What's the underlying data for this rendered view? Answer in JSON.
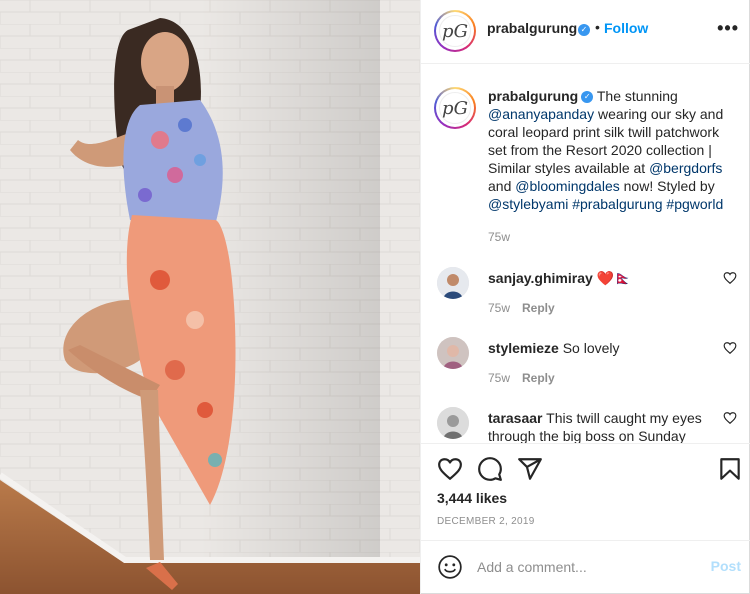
{
  "header": {
    "username": "prabalgurung",
    "verified_icon": "verified-badge-icon",
    "separator": "•",
    "follow_label": "Follow",
    "more_icon": "more-options-icon",
    "more_glyph": "•••"
  },
  "avatar": {
    "monogram": "pG"
  },
  "caption": {
    "username": "prabalgurung",
    "text_1": " The stunning ",
    "mention_1": "@ananyapanday",
    "text_2": " wearing our sky and coral leopard print silk twill patchwork set from the Resort 2020 collection | Similar styles available at ",
    "mention_2": "@bergdorfs",
    "text_3": " and ",
    "mention_3": "@bloomingdales",
    "text_4": " now! Styled by ",
    "mention_4": "@stylebyami",
    "text_5": " ",
    "hashtag_1": "#prabalgurung",
    "text_6": " ",
    "hashtag_2": "#pgworld",
    "time": "75w"
  },
  "comments": [
    {
      "username": "sanjay.ghimiray",
      "text": " ❤️🇳🇵",
      "time": "75w",
      "reply": "Reply"
    },
    {
      "username": "stylemieze",
      "text": " So lovely",
      "time": "75w",
      "reply": "Reply"
    },
    {
      "username": "tarasaar",
      "text": " This twill caught my eyes through the big boss on Sunday"
    }
  ],
  "actions": {
    "likes": "3,444 likes",
    "date": "DECEMBER 2, 2019"
  },
  "add_comment": {
    "placeholder": "Add a comment...",
    "post_label": "Post"
  },
  "colors": {
    "link_blue": "#0095f6",
    "mention_navy": "#00376b",
    "muted": "#8e8e8e",
    "post_disabled": "#b2dffc"
  }
}
